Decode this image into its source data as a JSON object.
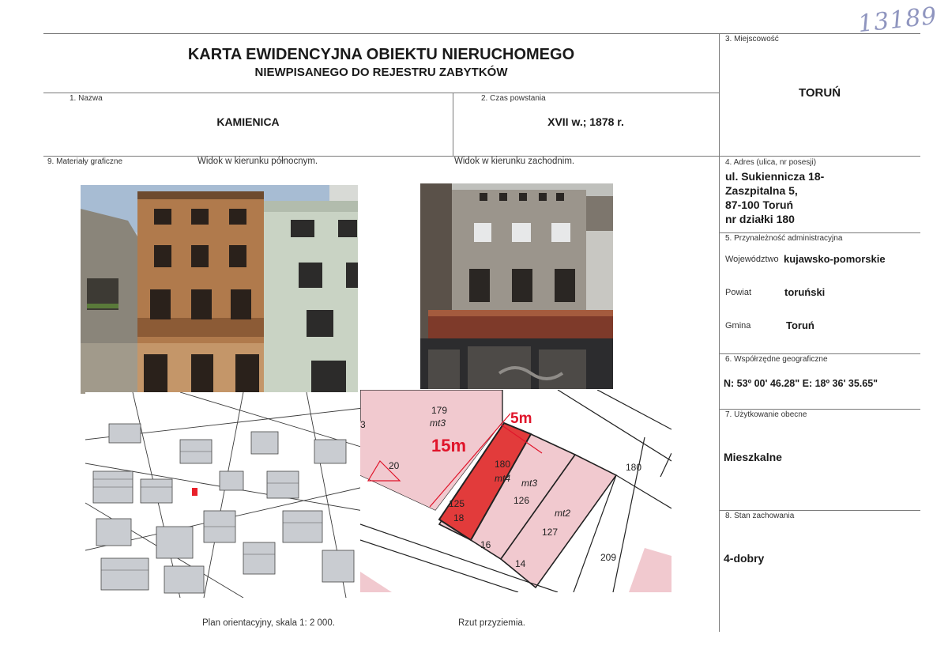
{
  "handwritten_number": "13189",
  "header": {
    "title": "KARTA EWIDENCYJNA OBIEKTU NIERUCHOMEGO",
    "subtitle": "NIEWPISANEGO DO REJESTRU ZABYTKÓW"
  },
  "fields": {
    "f1_label": "1.    Nazwa",
    "f1_value": "KAMIENICA",
    "f2_label": "2.    Czas powstania",
    "f2_value": "XVII w.; 1878 r.",
    "f3_label": "3. Miejscowość",
    "f3_value": "TORUŃ",
    "f4_label": "4. Adres (ulica, nr posesji)",
    "f4_lines": [
      "ul. Sukiennicza 18-",
      "Zaszpitalna 5,",
      "87-100 Toruń",
      "nr działki 180"
    ],
    "f5_label": "5. Przynależność administracyjna",
    "f5_woj_label": "Województwo",
    "f5_woj_value": "kujawsko-pomorskie",
    "f5_pow_label": "Powiat",
    "f5_pow_value": "toruński",
    "f5_gmina_label": "Gmina",
    "f5_gmina_value": "Toruń",
    "f6_label": "6. Współrzędne geograficzne",
    "f6_value": "N: 53º 00' 46.28\" E: 18º 36' 35.65\"",
    "f7_label": "7. Użytkowanie obecne",
    "f7_value": "Mieszkalne",
    "f8_label": "8. Stan zachowania",
    "f8_value": "4-dobry",
    "f9_label": "9. Materiały graficzne"
  },
  "captions": {
    "north": "Widok w kierunku północnym.",
    "west": "Widok w kierunku zachodnim.",
    "plan": "Plan orientacyjny, skala 1: 2 000.",
    "rzut": "Rzut przyziemia."
  },
  "parcel_map": {
    "labels": {
      "p179": "179",
      "mt3": "mt3",
      "p180": "180",
      "mt4": "mt4",
      "p125": "125",
      "n18": "18",
      "p126": "126",
      "mt3b": "mt3",
      "p127": "127",
      "mt2": "mt2",
      "n16": "16",
      "n14": "14",
      "p209": "209",
      "p180b": "180",
      "n20": "20",
      "m3": "3"
    },
    "dim_15": "15m",
    "dim_5": "5m"
  },
  "colors": {
    "line": "#7a7a7a",
    "parcel_highlight": "#e23b3b",
    "parcel_pink": "#f1c9cf",
    "plan_marker": "#e8202a",
    "dim_red": "#e0142a"
  }
}
